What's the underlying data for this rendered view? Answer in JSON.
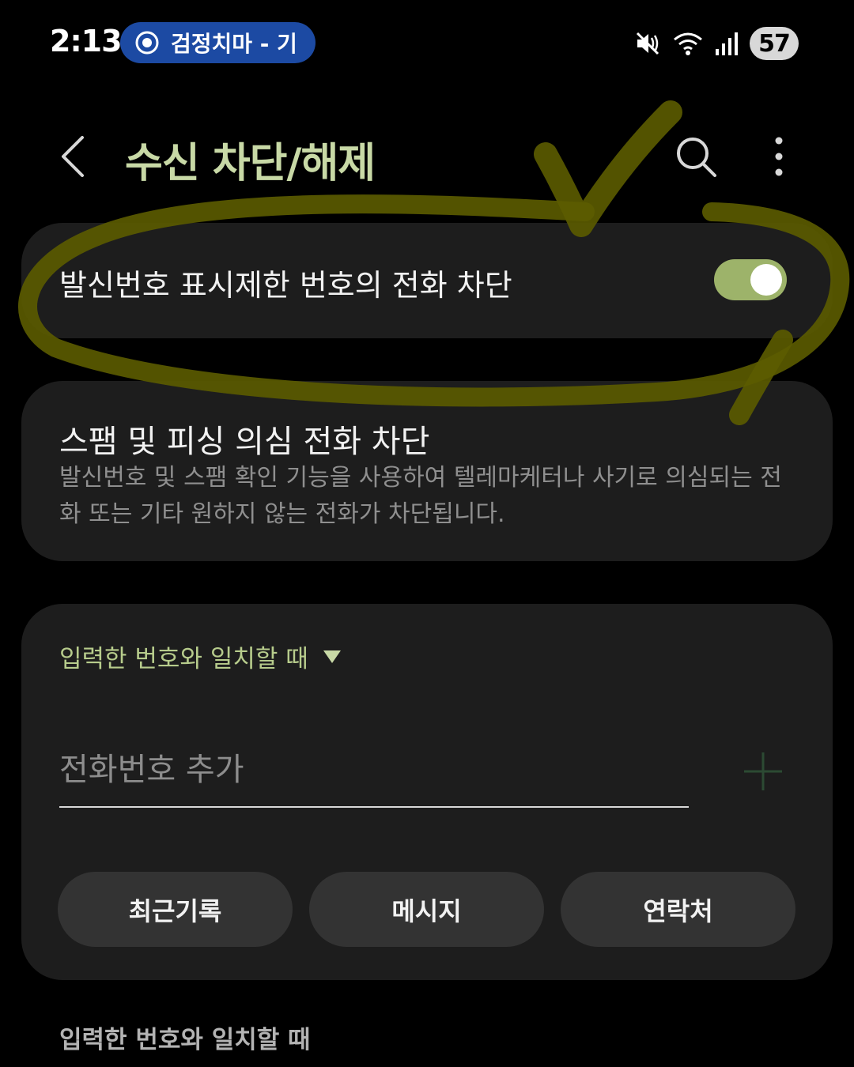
{
  "status_bar": {
    "time": "2:13",
    "media_text": "검정치마 - 기",
    "battery": "57",
    "icons": [
      "play-circle-icon",
      "mute-icon",
      "wifi-icon",
      "signal-icon",
      "battery-icon"
    ]
  },
  "header": {
    "title": "수신 차단/해제",
    "icons": [
      "back-icon",
      "search-icon",
      "more-icon"
    ]
  },
  "block_hidden": {
    "label": "발신번호 표시제한 번호의 전화 차단",
    "enabled": true
  },
  "spam": {
    "title": "스팸 및 피싱 의심 전화 차단",
    "description": "발신번호 및 스팸 확인 기능을 사용하여 텔레마케터나 사기로 의심되는 전화 또는 기타 원하지 않는 전화가 차단됩니다."
  },
  "add_number": {
    "match_option": "입력한 번호와 일치할 때",
    "placeholder": "전화번호 추가",
    "buttons": {
      "recent": "최근기록",
      "message": "메시지",
      "contacts": "연락처"
    }
  },
  "footer": {
    "section_label": "입력한 번호와 일치할 때"
  },
  "colors": {
    "accent": "#c8d9a6",
    "toggle_on": "#9db36a",
    "card": "#1d1d1d",
    "button": "#333333",
    "annotation": "#5c5c00",
    "media_pill": "#1c4aa3"
  }
}
